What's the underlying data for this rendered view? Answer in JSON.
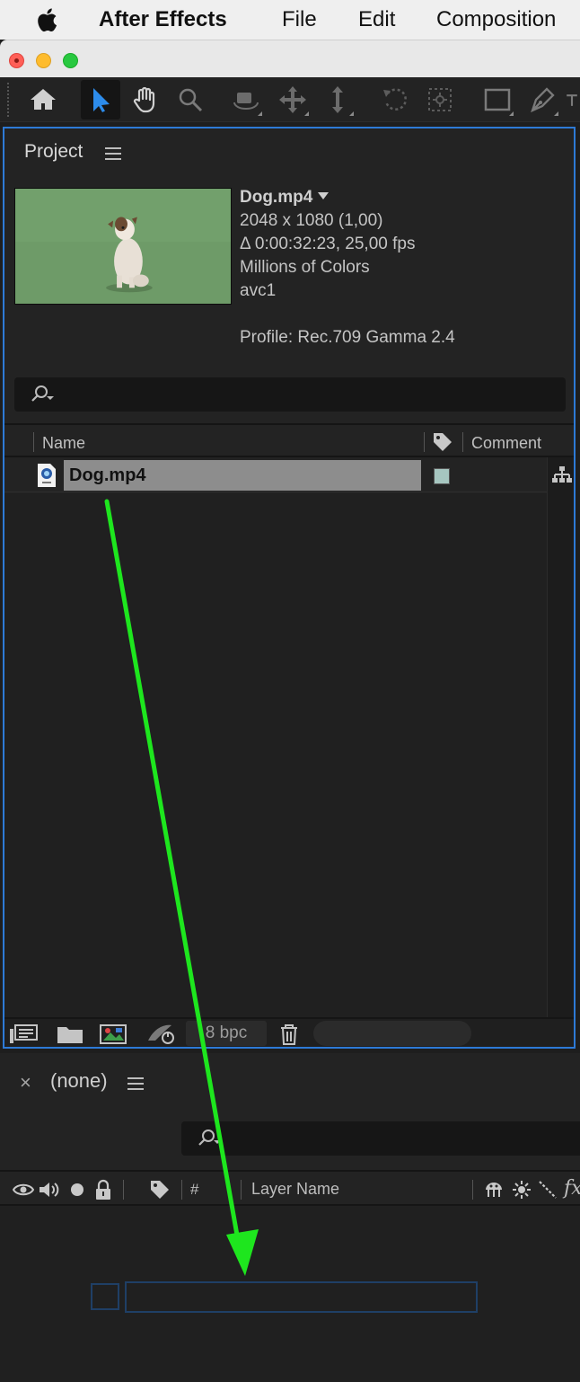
{
  "menubar": {
    "app_name": "After Effects",
    "items": [
      "File",
      "Edit",
      "Composition"
    ]
  },
  "toolbar": {
    "tools": [
      "home-icon",
      "selection-tool-icon",
      "hand-tool-icon",
      "zoom-tool-icon",
      "orbit-camera-icon",
      "pan-camera-icon",
      "dolly-camera-icon",
      "rotation-tool-icon",
      "anchor-point-icon",
      "rectangle-tool-icon",
      "pen-tool-icon"
    ],
    "active_tool": "selection-tool-icon",
    "active_color": "#2d8ceb"
  },
  "project": {
    "title": "Project",
    "footage": {
      "name": "Dog.mp4",
      "dimensions": "2048 x 1080 (1,00)",
      "duration": "Δ 0:00:32:23, 25,00 fps",
      "colors": "Millions of Colors",
      "codec": "avc1",
      "profile": "Profile: Rec.709 Gamma 2.4"
    },
    "columns": {
      "name": "Name",
      "comment": "Comment"
    },
    "items": [
      {
        "name": "Dog.mp4",
        "label_color": "#a6c6c0"
      }
    ],
    "footer": {
      "bpc": "8 bpc"
    },
    "border_color": "#2d7ad6"
  },
  "timeline": {
    "close": "×",
    "title": "(none)",
    "columns": {
      "hash": "#",
      "layer_name": "Layer Name",
      "fx": "fx"
    }
  },
  "annotation": {
    "arrow_color": "#1ee61e"
  }
}
